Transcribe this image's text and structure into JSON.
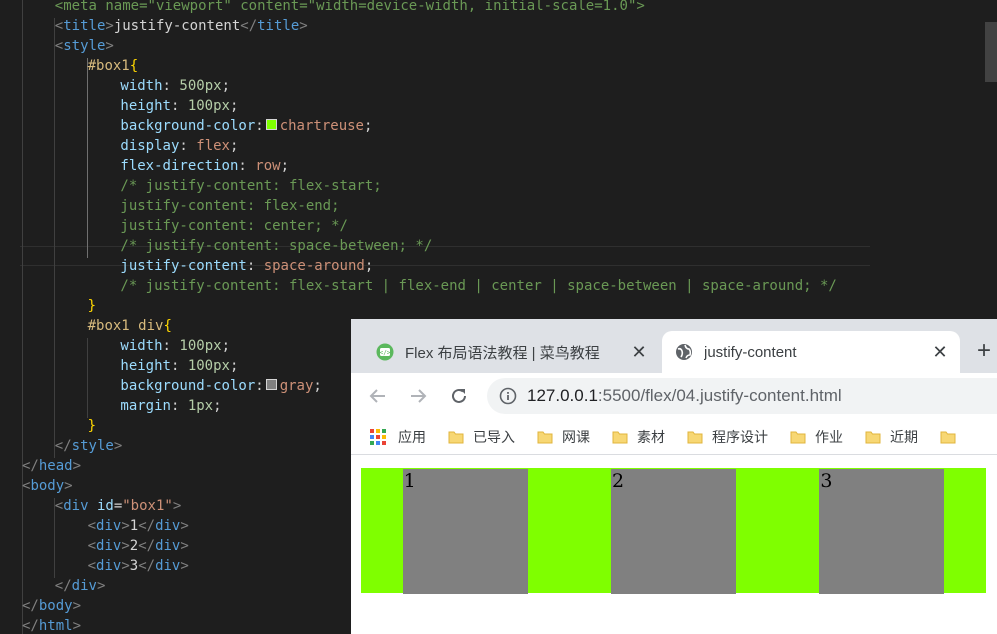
{
  "editor": {
    "lines": [
      {
        "indent": 4,
        "parts": [
          [
            "c",
            "<meta name=\"viewport\" content=\"width=device-width, initial-scale=1.0\">"
          ]
        ]
      },
      {
        "indent": 4,
        "parts": [
          [
            "p",
            "<"
          ],
          [
            "t",
            "title"
          ],
          [
            "p",
            ">"
          ],
          [
            "w",
            "justify-content"
          ],
          [
            "p",
            "</"
          ],
          [
            "t",
            "title"
          ],
          [
            "p",
            ">"
          ]
        ]
      },
      {
        "indent": 4,
        "parts": [
          [
            "p",
            "<"
          ],
          [
            "t",
            "style"
          ],
          [
            "p",
            ">"
          ]
        ]
      },
      {
        "indent": 8,
        "parts": [
          [
            "s",
            "#box1"
          ],
          [
            "b",
            "{"
          ]
        ]
      },
      {
        "indent": 12,
        "parts": [
          [
            "k",
            "width"
          ],
          [
            "w",
            ": "
          ],
          [
            "n",
            "500px"
          ],
          [
            "w",
            ";"
          ]
        ]
      },
      {
        "indent": 12,
        "parts": [
          [
            "k",
            "height"
          ],
          [
            "w",
            ": "
          ],
          [
            "n",
            "100px"
          ],
          [
            "w",
            ";"
          ]
        ]
      },
      {
        "indent": 12,
        "parts": [
          [
            "k",
            "background-color"
          ],
          [
            "w",
            ":"
          ],
          [
            "swatch",
            "#7fff00"
          ],
          [
            "v",
            "chartreuse"
          ],
          [
            "w",
            ";"
          ]
        ]
      },
      {
        "indent": 12,
        "parts": [
          [
            "k",
            "display"
          ],
          [
            "w",
            ": "
          ],
          [
            "v",
            "flex"
          ],
          [
            "w",
            ";"
          ]
        ]
      },
      {
        "indent": 12,
        "parts": [
          [
            "k",
            "flex-direction"
          ],
          [
            "w",
            ": "
          ],
          [
            "v",
            "row"
          ],
          [
            "w",
            ";"
          ]
        ]
      },
      {
        "indent": 12,
        "parts": [
          [
            "c",
            "/* justify-content: flex-start;"
          ]
        ]
      },
      {
        "indent": 12,
        "parts": [
          [
            "c",
            "justify-content: flex-end;"
          ]
        ]
      },
      {
        "indent": 12,
        "parts": [
          [
            "c",
            "justify-content: center; */"
          ]
        ]
      },
      {
        "indent": 12,
        "parts": [
          [
            "c",
            "/* justify-content: space-between; */"
          ]
        ]
      },
      {
        "indent": 12,
        "parts": [
          [
            "k",
            "justify-content"
          ],
          [
            "w",
            ": "
          ],
          [
            "v",
            "space-around"
          ],
          [
            "w",
            ";"
          ]
        ]
      },
      {
        "indent": 12,
        "parts": [
          [
            "c",
            "/* justify-content: flex-start | flex-end | center | space-between | space-around; */"
          ]
        ]
      },
      {
        "indent": 8,
        "parts": [
          [
            "b",
            "}"
          ]
        ]
      },
      {
        "indent": 8,
        "parts": [
          [
            "s",
            "#box1 div"
          ],
          [
            "b",
            "{"
          ]
        ]
      },
      {
        "indent": 12,
        "parts": [
          [
            "k",
            "width"
          ],
          [
            "w",
            ": "
          ],
          [
            "n",
            "100px"
          ],
          [
            "w",
            ";"
          ]
        ]
      },
      {
        "indent": 12,
        "parts": [
          [
            "k",
            "height"
          ],
          [
            "w",
            ": "
          ],
          [
            "n",
            "100px"
          ],
          [
            "w",
            ";"
          ]
        ]
      },
      {
        "indent": 12,
        "parts": [
          [
            "k",
            "background-color"
          ],
          [
            "w",
            ":"
          ],
          [
            "swatch",
            "#808080"
          ],
          [
            "v",
            "gray"
          ],
          [
            "w",
            ";"
          ]
        ]
      },
      {
        "indent": 12,
        "parts": [
          [
            "k",
            "margin"
          ],
          [
            "w",
            ": "
          ],
          [
            "n",
            "1px"
          ],
          [
            "w",
            ";"
          ]
        ]
      },
      {
        "indent": 8,
        "parts": [
          [
            "b",
            "}"
          ]
        ]
      },
      {
        "indent": 4,
        "parts": [
          [
            "p",
            "</"
          ],
          [
            "t",
            "style"
          ],
          [
            "p",
            ">"
          ]
        ]
      },
      {
        "indent": 0,
        "parts": [
          [
            "p",
            "</"
          ],
          [
            "t",
            "head"
          ],
          [
            "p",
            ">"
          ]
        ]
      },
      {
        "indent": 0,
        "parts": [
          [
            "p",
            "<"
          ],
          [
            "t",
            "body"
          ],
          [
            "p",
            ">"
          ]
        ]
      },
      {
        "indent": 4,
        "parts": [
          [
            "p",
            "<"
          ],
          [
            "t",
            "div "
          ],
          [
            "k",
            "id"
          ],
          [
            "w",
            "="
          ],
          [
            "v",
            "\"box1\""
          ],
          [
            "p",
            ">"
          ]
        ]
      },
      {
        "indent": 8,
        "parts": [
          [
            "p",
            "<"
          ],
          [
            "t",
            "div"
          ],
          [
            "p",
            ">"
          ],
          [
            "w",
            "1"
          ],
          [
            "p",
            "</"
          ],
          [
            "t",
            "div"
          ],
          [
            "p",
            ">"
          ]
        ]
      },
      {
        "indent": 8,
        "parts": [
          [
            "p",
            "<"
          ],
          [
            "t",
            "div"
          ],
          [
            "p",
            ">"
          ],
          [
            "w",
            "2"
          ],
          [
            "p",
            "</"
          ],
          [
            "t",
            "div"
          ],
          [
            "p",
            ">"
          ]
        ]
      },
      {
        "indent": 8,
        "parts": [
          [
            "p",
            "<"
          ],
          [
            "t",
            "div"
          ],
          [
            "p",
            ">"
          ],
          [
            "w",
            "3"
          ],
          [
            "p",
            "</"
          ],
          [
            "t",
            "div"
          ],
          [
            "p",
            ">"
          ]
        ]
      },
      {
        "indent": 4,
        "parts": [
          [
            "p",
            "</"
          ],
          [
            "t",
            "div"
          ],
          [
            "p",
            ">"
          ]
        ]
      },
      {
        "indent": 0,
        "parts": [
          [
            "p",
            "</"
          ],
          [
            "t",
            "body"
          ],
          [
            "p",
            ">"
          ]
        ]
      },
      {
        "indent": 0,
        "parts": [
          [
            "p",
            "</"
          ],
          [
            "t",
            "html"
          ],
          [
            "p",
            ">"
          ]
        ]
      }
    ]
  },
  "browser": {
    "tabs": [
      {
        "title": "Flex 布局语法教程 | 菜鸟教程",
        "active": false,
        "icon": "runoob-favicon-icon"
      },
      {
        "title": "justify-content",
        "active": true,
        "icon": "globe-icon"
      }
    ],
    "close_glyph": "✕",
    "new_tab_glyph": "+",
    "url_host": "127.0.0.1",
    "url_rest": ":5500/flex/04.justify-content.html",
    "bookmarks": [
      {
        "label": "应用",
        "icon": "apps-grid-icon"
      },
      {
        "label": "已导入",
        "icon": "folder-icon"
      },
      {
        "label": "网课",
        "icon": "folder-icon"
      },
      {
        "label": "素材",
        "icon": "folder-icon"
      },
      {
        "label": "程序设计",
        "icon": "folder-icon"
      },
      {
        "label": "作业",
        "icon": "folder-icon"
      },
      {
        "label": "近期",
        "icon": "folder-icon"
      },
      {
        "label": "",
        "icon": "folder-icon"
      }
    ],
    "page": {
      "box_color": "#7fff00",
      "item_color": "#808080",
      "items": [
        "1",
        "2",
        "3"
      ]
    }
  }
}
